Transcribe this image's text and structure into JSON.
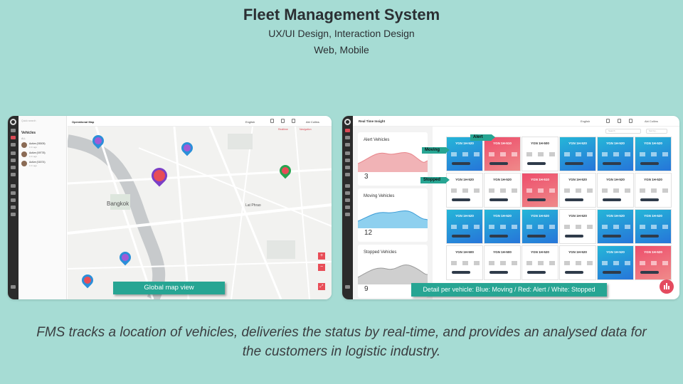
{
  "header": {
    "title": "Fleet Management System",
    "subtitle": "UX/UI Design, Interaction Design",
    "platforms": "Web, Mobile"
  },
  "left_screen": {
    "search_placeholder": "Quick search",
    "vehicles_heading": "Vehicles",
    "all_label": "ALL",
    "vehicle_rows": [
      {
        "name": "Active (05305)",
        "sub": "1 hr ago"
      },
      {
        "name": "Active (09778)",
        "sub": "1 hr ago"
      },
      {
        "name": "Active (01574)",
        "sub": "1 hr ago"
      }
    ],
    "page_title": "Operational Map",
    "language": "English",
    "user": "Abi Collins",
    "map_tab_1": "Realtime",
    "map_tab_2": "Navigation",
    "map_labels": {
      "city": "Bangkok",
      "district": "Lat Phrao"
    },
    "zoom_in": "+",
    "zoom_out": "−",
    "callout": "Global map view"
  },
  "right_screen": {
    "page_title": "Real Time Insight",
    "language": "English",
    "user": "Abi Collins",
    "search_placeholder": "Search",
    "sort_placeholder": "Sort by...",
    "metrics": [
      {
        "label": "Alert Vehicles",
        "count": "3",
        "color": "#e8848a"
      },
      {
        "label": "Moving Vehicles",
        "count": "12",
        "color": "#3a9bd6"
      },
      {
        "label": "Stopped Vehicles",
        "count": "9",
        "color": "#9a9a9a"
      }
    ],
    "vehicle_grid": [
      [
        "blue",
        "red",
        "white",
        "blue",
        "blue",
        "blue"
      ],
      [
        "white",
        "white",
        "red",
        "white",
        "white",
        "white"
      ],
      [
        "blue",
        "blue",
        "blue",
        "white",
        "blue",
        "blue"
      ],
      [
        "white",
        "white",
        "white",
        "white",
        "blue",
        "red"
      ]
    ],
    "vehicle_codes": [
      [
        "YGN 1H-520",
        "YGN 1H-510",
        "YGN 1H-500",
        "YGN 1H-520",
        "YGN 1H-520",
        "YGN 1H-520"
      ],
      [
        "YGN 1H-520",
        "YGN 1H-520",
        "YGN 1H-510",
        "YGN 1H-520",
        "YGN 1H-520",
        "YGN 1H-520"
      ],
      [
        "YGN 1H-520",
        "YGN 1H-520",
        "YGN 1H-520",
        "YGN 1H-520",
        "YGN 1H-520",
        "YGN 1H-520"
      ],
      [
        "YGN 1H-500",
        "YGN 1H-500",
        "YGN 1H-520",
        "YGN 1H-520",
        "YGN 1H-520",
        "YGN 1H-520"
      ]
    ],
    "tags": {
      "alert": "Alert",
      "moving": "Moving",
      "stopped": "Stopped"
    },
    "callout": "Detail per vehicle: Blue: Moving / Red: Alert / White: Stopped"
  },
  "caption": "FMS tracks a location of vehicles, deliveries the status by real-time, and provides an analysed data for the customers in logistic industry.",
  "colors": {
    "background": "#a6dcd4",
    "accent": "#27a593",
    "alert": "#e84d57",
    "moving": "#2675d9"
  }
}
